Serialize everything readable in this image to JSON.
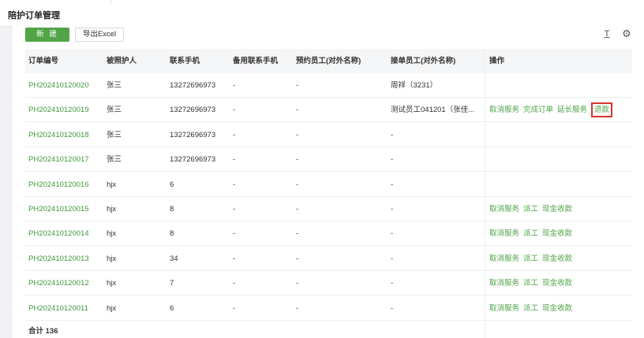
{
  "page": {
    "title": "陪护订单管理"
  },
  "toolbar": {
    "new_label": "新 建",
    "export_label": "导出Excel",
    "text_size_icon": "text-size-icon",
    "settings_icon": "gear-icon"
  },
  "table": {
    "headers": [
      "订单编号",
      "被照护人",
      "联系手机",
      "备用联系手机",
      "预约员工(对外名称)",
      "接单员工(对外名称)",
      "操作"
    ],
    "rows": [
      {
        "order_no": "PH202410120020",
        "patient": "张三",
        "phone": "13272696973",
        "backup_phone": "-",
        "reserved_staff": "-",
        "accepted_staff": "周祥（3231）",
        "actions": []
      },
      {
        "order_no": "PH202410120019",
        "patient": "张三",
        "phone": "13272696973",
        "backup_phone": "-",
        "reserved_staff": "-",
        "accepted_staff": "测试员工041201（张佳...",
        "actions": [
          "取消服务",
          "完成订单",
          "延长服务"
        ],
        "highlight_action": "退款"
      },
      {
        "order_no": "PH202410120018",
        "patient": "张三",
        "phone": "13272696973",
        "backup_phone": "-",
        "reserved_staff": "-",
        "accepted_staff": "-",
        "actions": []
      },
      {
        "order_no": "PH202410120017",
        "patient": "张三",
        "phone": "13272696973",
        "backup_phone": "-",
        "reserved_staff": "-",
        "accepted_staff": "-",
        "actions": []
      },
      {
        "order_no": "PH202410120016",
        "patient": "hjx",
        "phone": "6",
        "backup_phone": "-",
        "reserved_staff": "-",
        "accepted_staff": "-",
        "actions": []
      },
      {
        "order_no": "PH202410120015",
        "patient": "hjx",
        "phone": "8",
        "backup_phone": "-",
        "reserved_staff": "-",
        "accepted_staff": "-",
        "actions": [
          "取消服务",
          "派工",
          "现金收款"
        ]
      },
      {
        "order_no": "PH202410120014",
        "patient": "hjx",
        "phone": "8",
        "backup_phone": "-",
        "reserved_staff": "-",
        "accepted_staff": "-",
        "actions": [
          "取消服务",
          "派工",
          "现金收款"
        ]
      },
      {
        "order_no": "PH202410120013",
        "patient": "hjx",
        "phone": "34",
        "backup_phone": "-",
        "reserved_staff": "-",
        "accepted_staff": "-",
        "actions": [
          "取消服务",
          "派工",
          "现金收款"
        ]
      },
      {
        "order_no": "PH202410120012",
        "patient": "hjx",
        "phone": "7",
        "backup_phone": "-",
        "reserved_staff": "-",
        "accepted_staff": "-",
        "actions": [
          "取消服务",
          "派工",
          "现金收款"
        ]
      },
      {
        "order_no": "PH202410120011",
        "patient": "hjx",
        "phone": "6",
        "backup_phone": "-",
        "reserved_staff": "-",
        "accepted_staff": "-",
        "actions": [
          "取消服务",
          "派工",
          "现金收款"
        ]
      }
    ],
    "total_label": "合计 136"
  },
  "colors": {
    "accent": "#52a447",
    "link": "#3e9a3a",
    "highlight_border": "#d9342b"
  }
}
